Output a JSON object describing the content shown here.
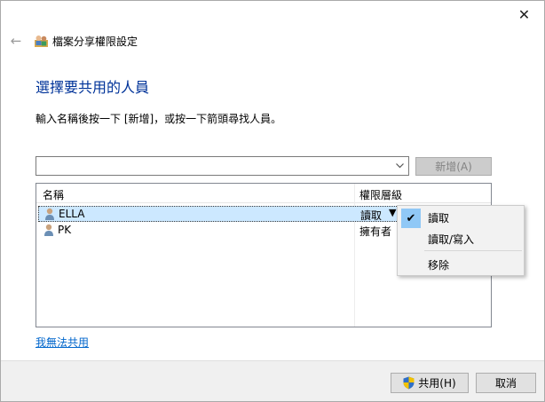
{
  "window": {
    "close_glyph": "✕"
  },
  "header": {
    "back_glyph": "←",
    "title": "檔案分享權限設定"
  },
  "main": {
    "heading": "選擇要共用的人員",
    "instruction": "輸入名稱後按一下 [新增]，或按一下箭頭尋找人員。",
    "combo": {
      "value": "",
      "placeholder": ""
    },
    "add_button": "新增(A)"
  },
  "list": {
    "columns": [
      "名稱",
      "權限層級"
    ],
    "rows": [
      {
        "name": "ELLA",
        "permission": "讀取",
        "arrow": "▼"
      },
      {
        "name": "PK",
        "permission": "擁有者"
      }
    ]
  },
  "menu": {
    "check_glyph": "✔",
    "items": [
      "讀取",
      "讀取/寫入",
      "移除"
    ]
  },
  "link": "我無法共用",
  "footer": {
    "share_button": "共用(H)",
    "cancel_button": "取消"
  },
  "colors": {
    "heading": "#003399",
    "selection": "#cce8ff",
    "check_highlight": "#90c8f6",
    "link": "#0066cc"
  }
}
